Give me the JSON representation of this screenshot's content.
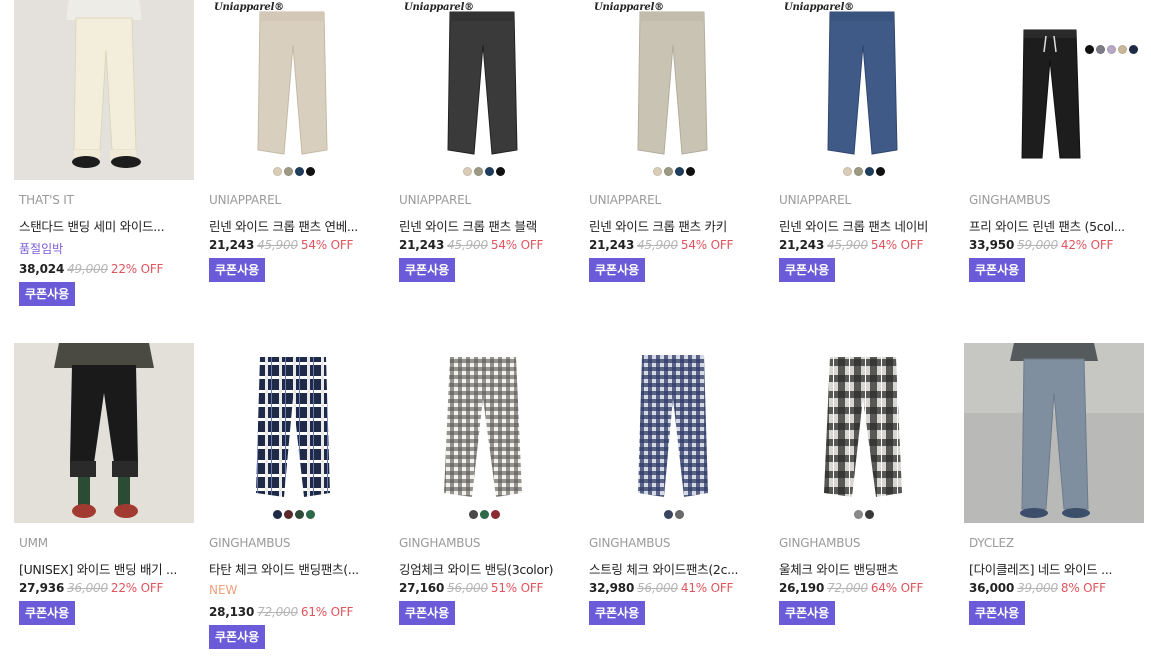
{
  "coupon_label": "쿠폰사용",
  "row1": [
    {
      "brand": "THAT'S IT",
      "name": "스탠다드 밴딩 세미 와이드...",
      "tag": "품절임박",
      "price": "38,024",
      "original": "49,000",
      "discount": "22% OFF"
    },
    {
      "brand": "UNIAPPAREL",
      "name": "린넨 와이드 크롭 팬츠 연베...",
      "logo": "Uniapparel®",
      "price": "21,243",
      "original": "45,900",
      "discount": "54% OFF",
      "swatches": [
        "#d9cdb8",
        "#9c9a83",
        "#1f3d5c",
        "#111111"
      ]
    },
    {
      "brand": "UNIAPPAREL",
      "name": "린넨 와이드 크롭 팬츠 블랙",
      "logo": "Uniapparel®",
      "price": "21,243",
      "original": "45,900",
      "discount": "54% OFF",
      "swatches": [
        "#d9cdb8",
        "#9c9a83",
        "#1f3d5c",
        "#111111"
      ]
    },
    {
      "brand": "UNIAPPAREL",
      "name": "린넨 와이드 크롭 팬츠 카키",
      "logo": "Uniapparel®",
      "price": "21,243",
      "original": "45,900",
      "discount": "54% OFF",
      "swatches": [
        "#d9cdb8",
        "#9c9a83",
        "#1f3d5c",
        "#111111"
      ]
    },
    {
      "brand": "UNIAPPAREL",
      "name": "린넨 와이드 크롭 팬츠 네이비",
      "logo": "Uniapparel®",
      "price": "21,243",
      "original": "45,900",
      "discount": "54% OFF",
      "swatches": [
        "#d9cdb8",
        "#9c9a83",
        "#1f3d5c",
        "#111111"
      ]
    },
    {
      "brand": "GINGHAMBUS",
      "name": "프리 와이드 린넨 팬츠 (5col...",
      "price": "33,950",
      "original": "59,000",
      "discount": "42% OFF",
      "swatches": [
        "#111111",
        "#7d7c86",
        "#b7a9c4",
        "#c9b79c",
        "#1e2b45"
      ]
    }
  ],
  "row2": [
    {
      "brand": "UMM",
      "name": "[UNISEX] 와이드 밴딩 배기 ...",
      "price": "27,936",
      "original": "36,000",
      "discount": "22% OFF"
    },
    {
      "brand": "GINGHAMBUS",
      "name": "타탄 체크 와이드 밴딩팬츠(...",
      "tag": "NEW",
      "price": "28,130",
      "original": "72,000",
      "discount": "61% OFF",
      "swatches": [
        "#1f2a48",
        "#5a2a2a",
        "#2f4a3a",
        "#2c6b4a"
      ]
    },
    {
      "brand": "GINGHAMBUS",
      "name": "깅엄체크 와이드 밴딩(3color)",
      "price": "27,160",
      "original": "56,000",
      "discount": "51% OFF",
      "swatches": [
        "#4a4a4a",
        "#2f6b4a",
        "#8c2c33"
      ]
    },
    {
      "brand": "GINGHAMBUS",
      "name": "스트링 체크 와이드팬츠(2c...",
      "price": "32,980",
      "original": "56,000",
      "discount": "41% OFF",
      "swatches": [
        "#3b4560",
        "#6a6a6a"
      ]
    },
    {
      "brand": "GINGHAMBUS",
      "name": "울체크 와이드 밴딩팬츠",
      "price": "26,190",
      "original": "72,000",
      "discount": "64% OFF",
      "swatches": [
        "#8a8a8a",
        "#3a3a3a"
      ]
    },
    {
      "brand": "DYCLEZ",
      "name": "[다이클레즈] 네드 와이드 ...",
      "price": "36,000",
      "original": "39,000",
      "discount": "8% OFF"
    }
  ],
  "colors": {
    "accent": "#6b5bd8",
    "discount": "#e0545d",
    "soldout": "#7b5cd6",
    "new": "#f0a080"
  },
  "icons": {
    "swatch": "color-swatch-dot"
  }
}
